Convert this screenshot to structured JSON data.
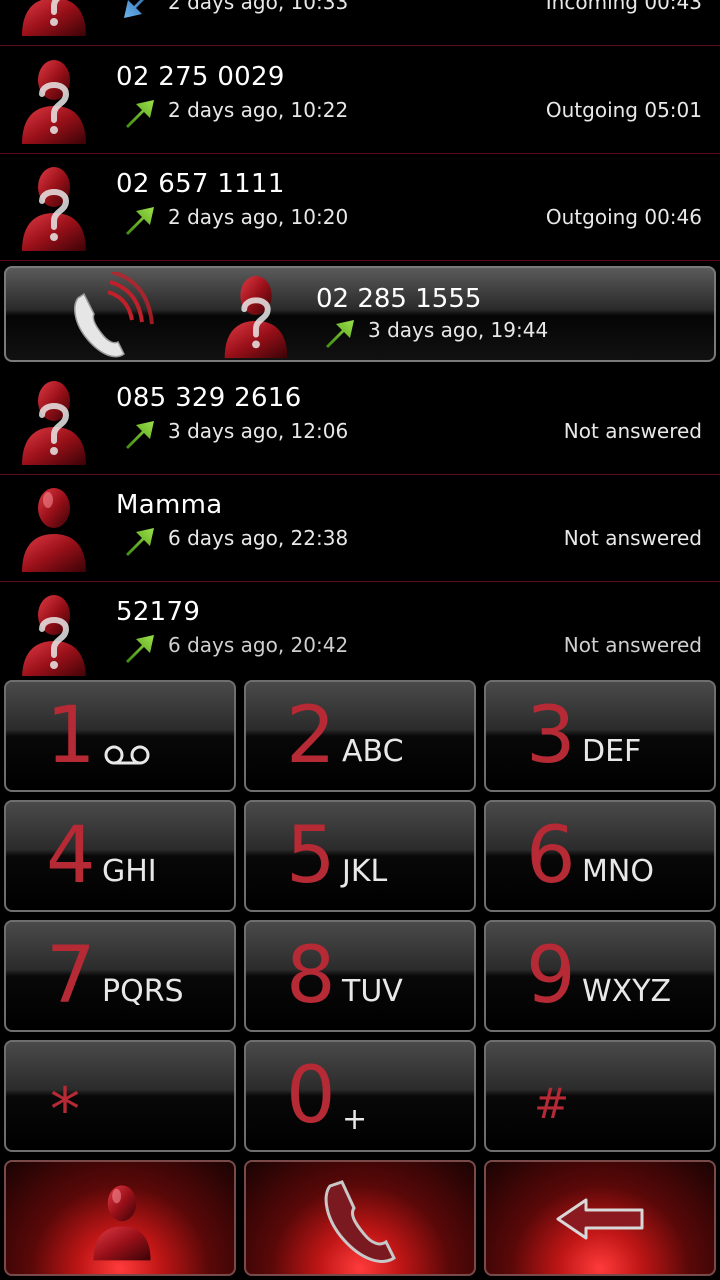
{
  "call_log": {
    "rows": [
      {
        "name": "",
        "time": "2 days ago, 10:33",
        "status": "Incoming 00:43",
        "direction": "incoming"
      },
      {
        "name": "02 275 0029",
        "time": "2 days ago, 10:22",
        "status": "Outgoing 05:01",
        "direction": "outgoing"
      },
      {
        "name": "02 657 1111",
        "time": "2 days ago, 10:20",
        "status": "Outgoing 00:46",
        "direction": "outgoing"
      },
      {
        "name": "085 329 2616",
        "time": "3 days ago, 12:06",
        "status": "Not answered",
        "direction": "outgoing"
      },
      {
        "name": "Mamma",
        "time": "6 days ago, 22:38",
        "status": "Not answered",
        "direction": "outgoing"
      },
      {
        "name": "52179",
        "time": "6 days ago, 20:42",
        "status": "Not answered",
        "direction": "outgoing"
      }
    ],
    "selected": {
      "name": "02 285 1555",
      "time": "3 days ago, 19:44",
      "direction": "outgoing"
    }
  },
  "dialpad": {
    "keys": [
      {
        "num": "1",
        "letters": ""
      },
      {
        "num": "2",
        "letters": "ABC"
      },
      {
        "num": "3",
        "letters": "DEF"
      },
      {
        "num": "4",
        "letters": "GHI"
      },
      {
        "num": "5",
        "letters": "JKL"
      },
      {
        "num": "6",
        "letters": "MNO"
      },
      {
        "num": "7",
        "letters": "PQRS"
      },
      {
        "num": "8",
        "letters": "TUV"
      },
      {
        "num": "9",
        "letters": "WXYZ"
      },
      {
        "num": "*",
        "letters": ""
      },
      {
        "num": "0",
        "letters": "+"
      },
      {
        "num": "#",
        "letters": ""
      }
    ]
  },
  "colors": {
    "accent_red": "#b52a34",
    "outgoing_arrow": "#6dbf2a",
    "incoming_arrow": "#3a8fd6",
    "divider": "#5a0a14"
  },
  "icons": {
    "contact": "contact-silhouette-icon",
    "unknown_contact": "unknown-contact-icon",
    "outgoing": "outgoing-call-arrow-icon",
    "incoming": "incoming-call-arrow-icon",
    "voicemail": "voicemail-icon",
    "call": "call-handset-icon",
    "backspace": "backspace-icon"
  }
}
